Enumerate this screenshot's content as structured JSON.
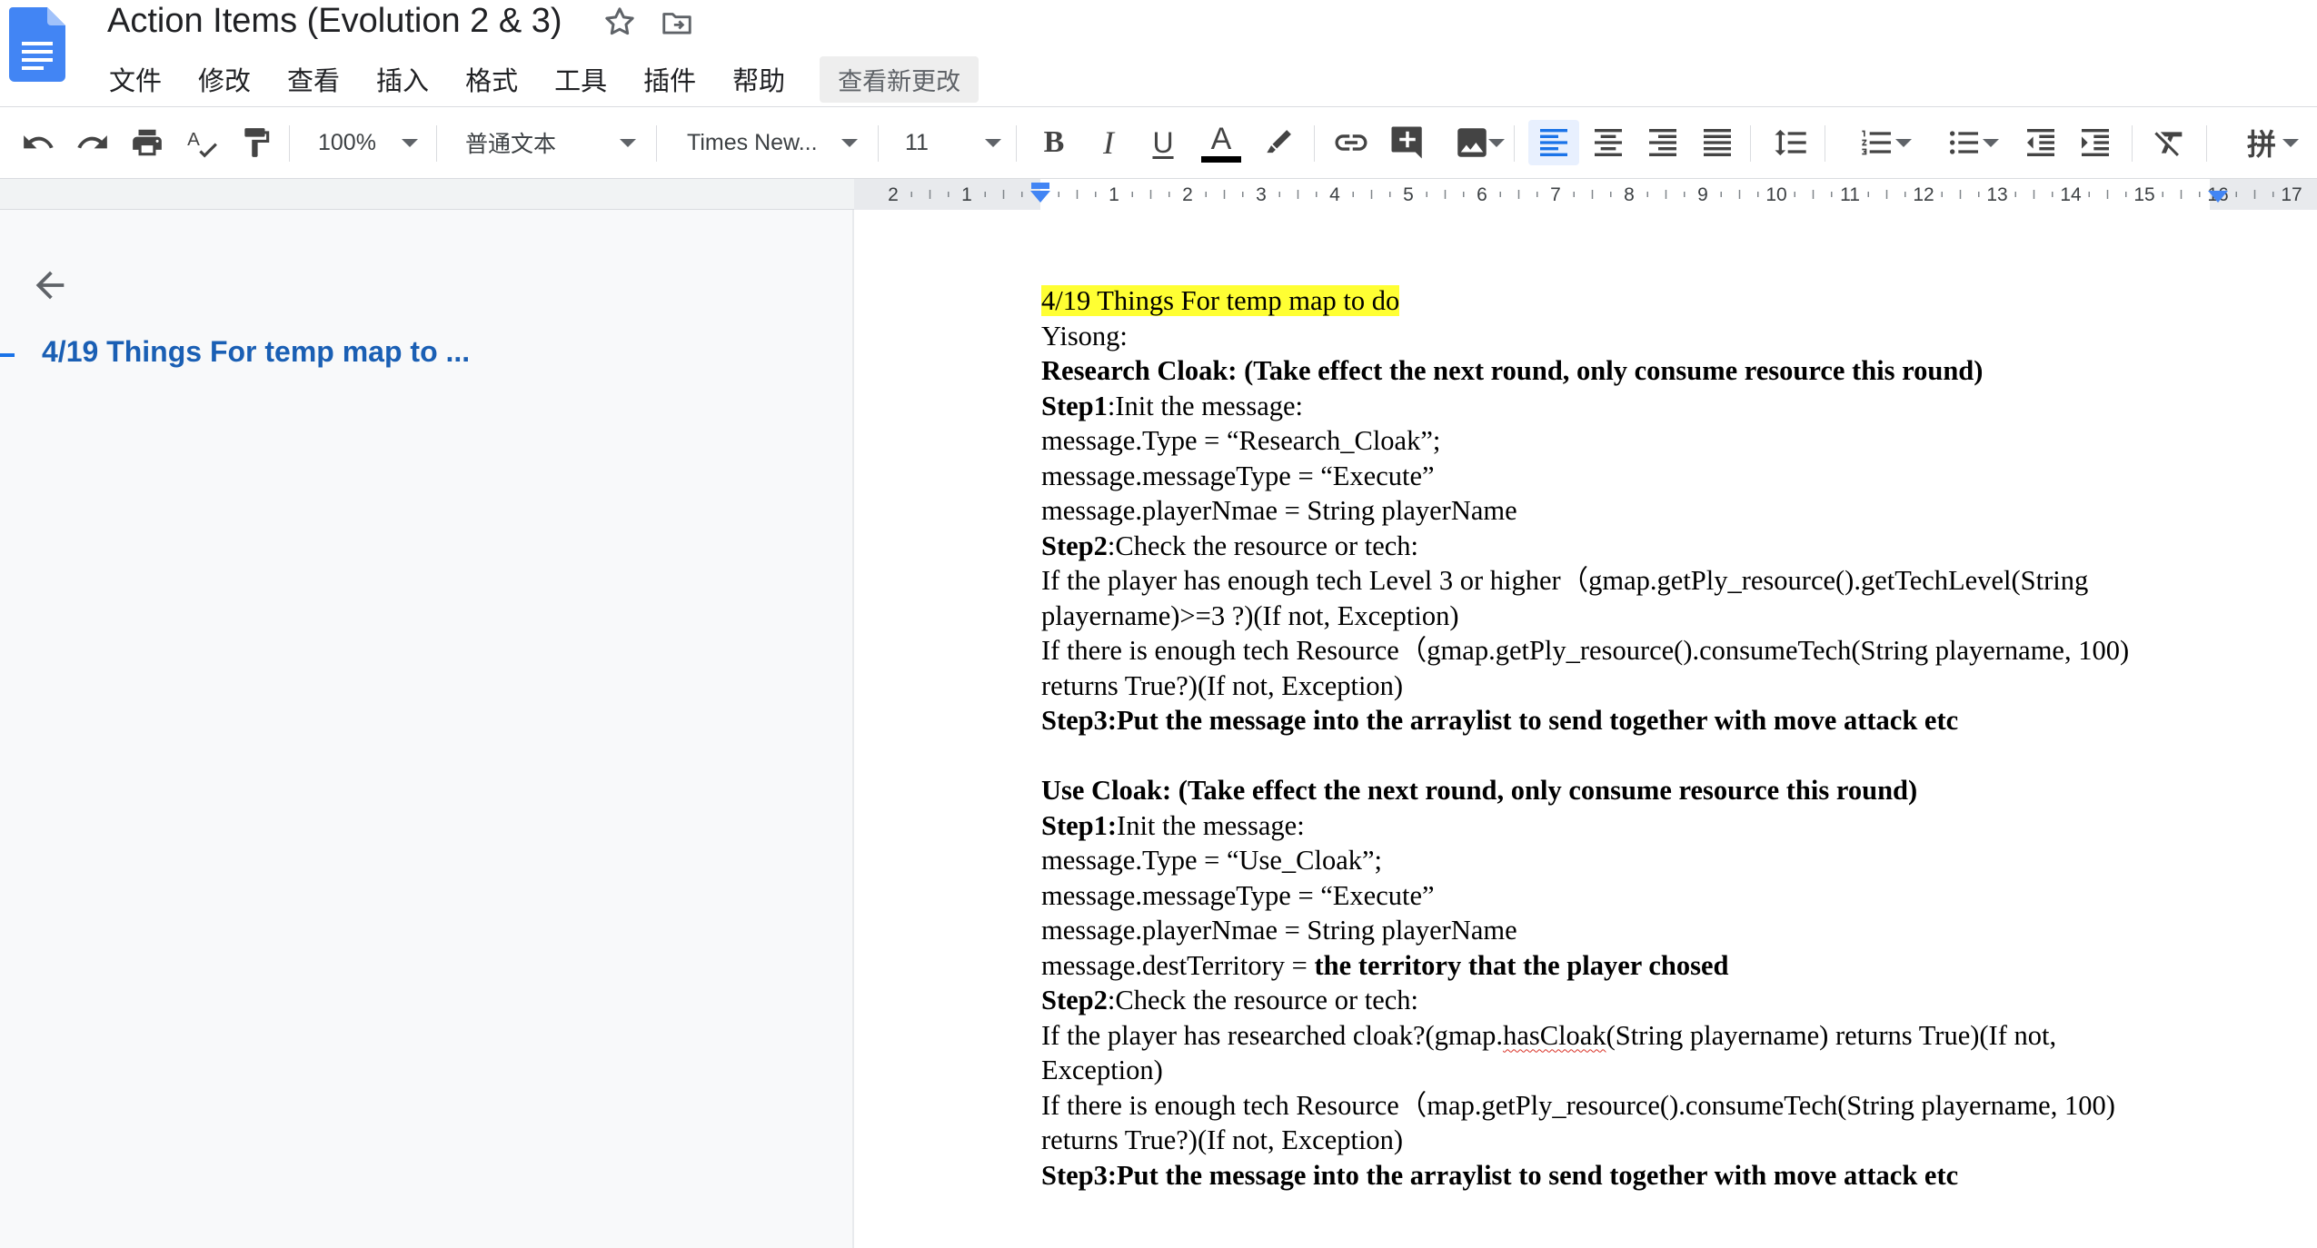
{
  "app": {
    "title": "Action Items (Evolution 2 & 3)",
    "logo_icon": "google-docs-icon",
    "star_icon": "star-outline-icon",
    "move_icon": "move-to-folder-icon"
  },
  "menu": {
    "items": [
      "文件",
      "修改",
      "查看",
      "插入",
      "格式",
      "工具",
      "插件",
      "帮助"
    ],
    "see_changes": "查看新更改"
  },
  "toolbar": {
    "zoom": "100%",
    "style": "普通文本",
    "font": "Times New...",
    "font_size": "11",
    "icons": [
      "undo-icon",
      "redo-icon",
      "print-icon",
      "spellcheck-icon",
      "paint-format-icon",
      "bold-icon",
      "italic-icon",
      "underline-icon",
      "text-color-icon",
      "highlight-icon",
      "link-icon",
      "add-comment-icon",
      "insert-image-icon",
      "align-left-icon",
      "align-center-icon",
      "align-right-icon",
      "align-justify-icon",
      "line-spacing-icon",
      "numbered-list-icon",
      "bulleted-list-icon",
      "decrease-indent-icon",
      "increase-indent-icon",
      "clear-formatting-icon",
      "input-tools-icon"
    ],
    "input_tools_label": "拼",
    "bold_label": "B",
    "italic_label": "I",
    "underline_label": "U",
    "text_color_label": "A",
    "text_color": "#000000",
    "accent_color": "#1a73e8"
  },
  "ruler": {
    "labels": [
      "2",
      "1",
      "1",
      "2",
      "3",
      "4",
      "5",
      "6",
      "7",
      "8",
      "9",
      "10",
      "11",
      "12",
      "13",
      "14",
      "15",
      "16",
      "17"
    ]
  },
  "outline": {
    "back_icon": "arrow-left-icon",
    "heading": "4/19 Things For temp map to ..."
  },
  "document": {
    "highlight_color": "#ffff33",
    "heading": "4/19 Things For temp map to do",
    "author": "Yisong:",
    "s1": {
      "title": "Research Cloak: (Take effect the next round, only consume resource this round)",
      "step1_label": "Step1",
      "step1_text": ":Init the message:",
      "type_line": "message.Type = “Research_Cloak”;",
      "msgtype_line": "message.messageType = “Execute”",
      "player_line": "message.playerNmae = String playerName",
      "step2_label": "Step2",
      "step2_text": ":Check the resource or tech:",
      "check1_a": "If the player has enough tech Level 3 or higher（gmap.getPly_resource().getTechLevel(String",
      "check1_b": "playername)>=3 ?)(If not, Exception)",
      "check2_a": "If there is enough tech Resource（gmap.getPly_resource().consumeTech(String playername, 100)",
      "check2_b": "returns True?)(If not, Exception)",
      "step3": "Step3:Put the message into the arraylist to send together with move attack etc"
    },
    "s2": {
      "title": "Use Cloak: (Take effect the next round, only consume resource this round)",
      "step1_label": "Step1:",
      "step1_text": "Init the message:",
      "type_line": "message.Type = “Use_Cloak”;",
      "msgtype_line": "message.messageType = “Execute”",
      "player_line": "message.playerNmae = String playerName",
      "dest_prefix": "message.destTerritory = ",
      "dest_bold": "the territory that the player chosed",
      "step2_label": "Step2",
      "step2_text": ":Check the resource or tech:",
      "check1_pre": "If the player has researched cloak?(gmap.",
      "check1_misspelled": "hasCloak",
      "check1_post": "(String playername) returns True)(If not,",
      "check1_b": "Exception)",
      "check2_a": "If there is enough tech Resource（map.getPly_resource().consumeTech(String playername, 100)",
      "check2_b": "returns True?)(If not, Exception)",
      "step3": "Step3:Put the message into the arraylist to send together with move attack etc"
    }
  }
}
